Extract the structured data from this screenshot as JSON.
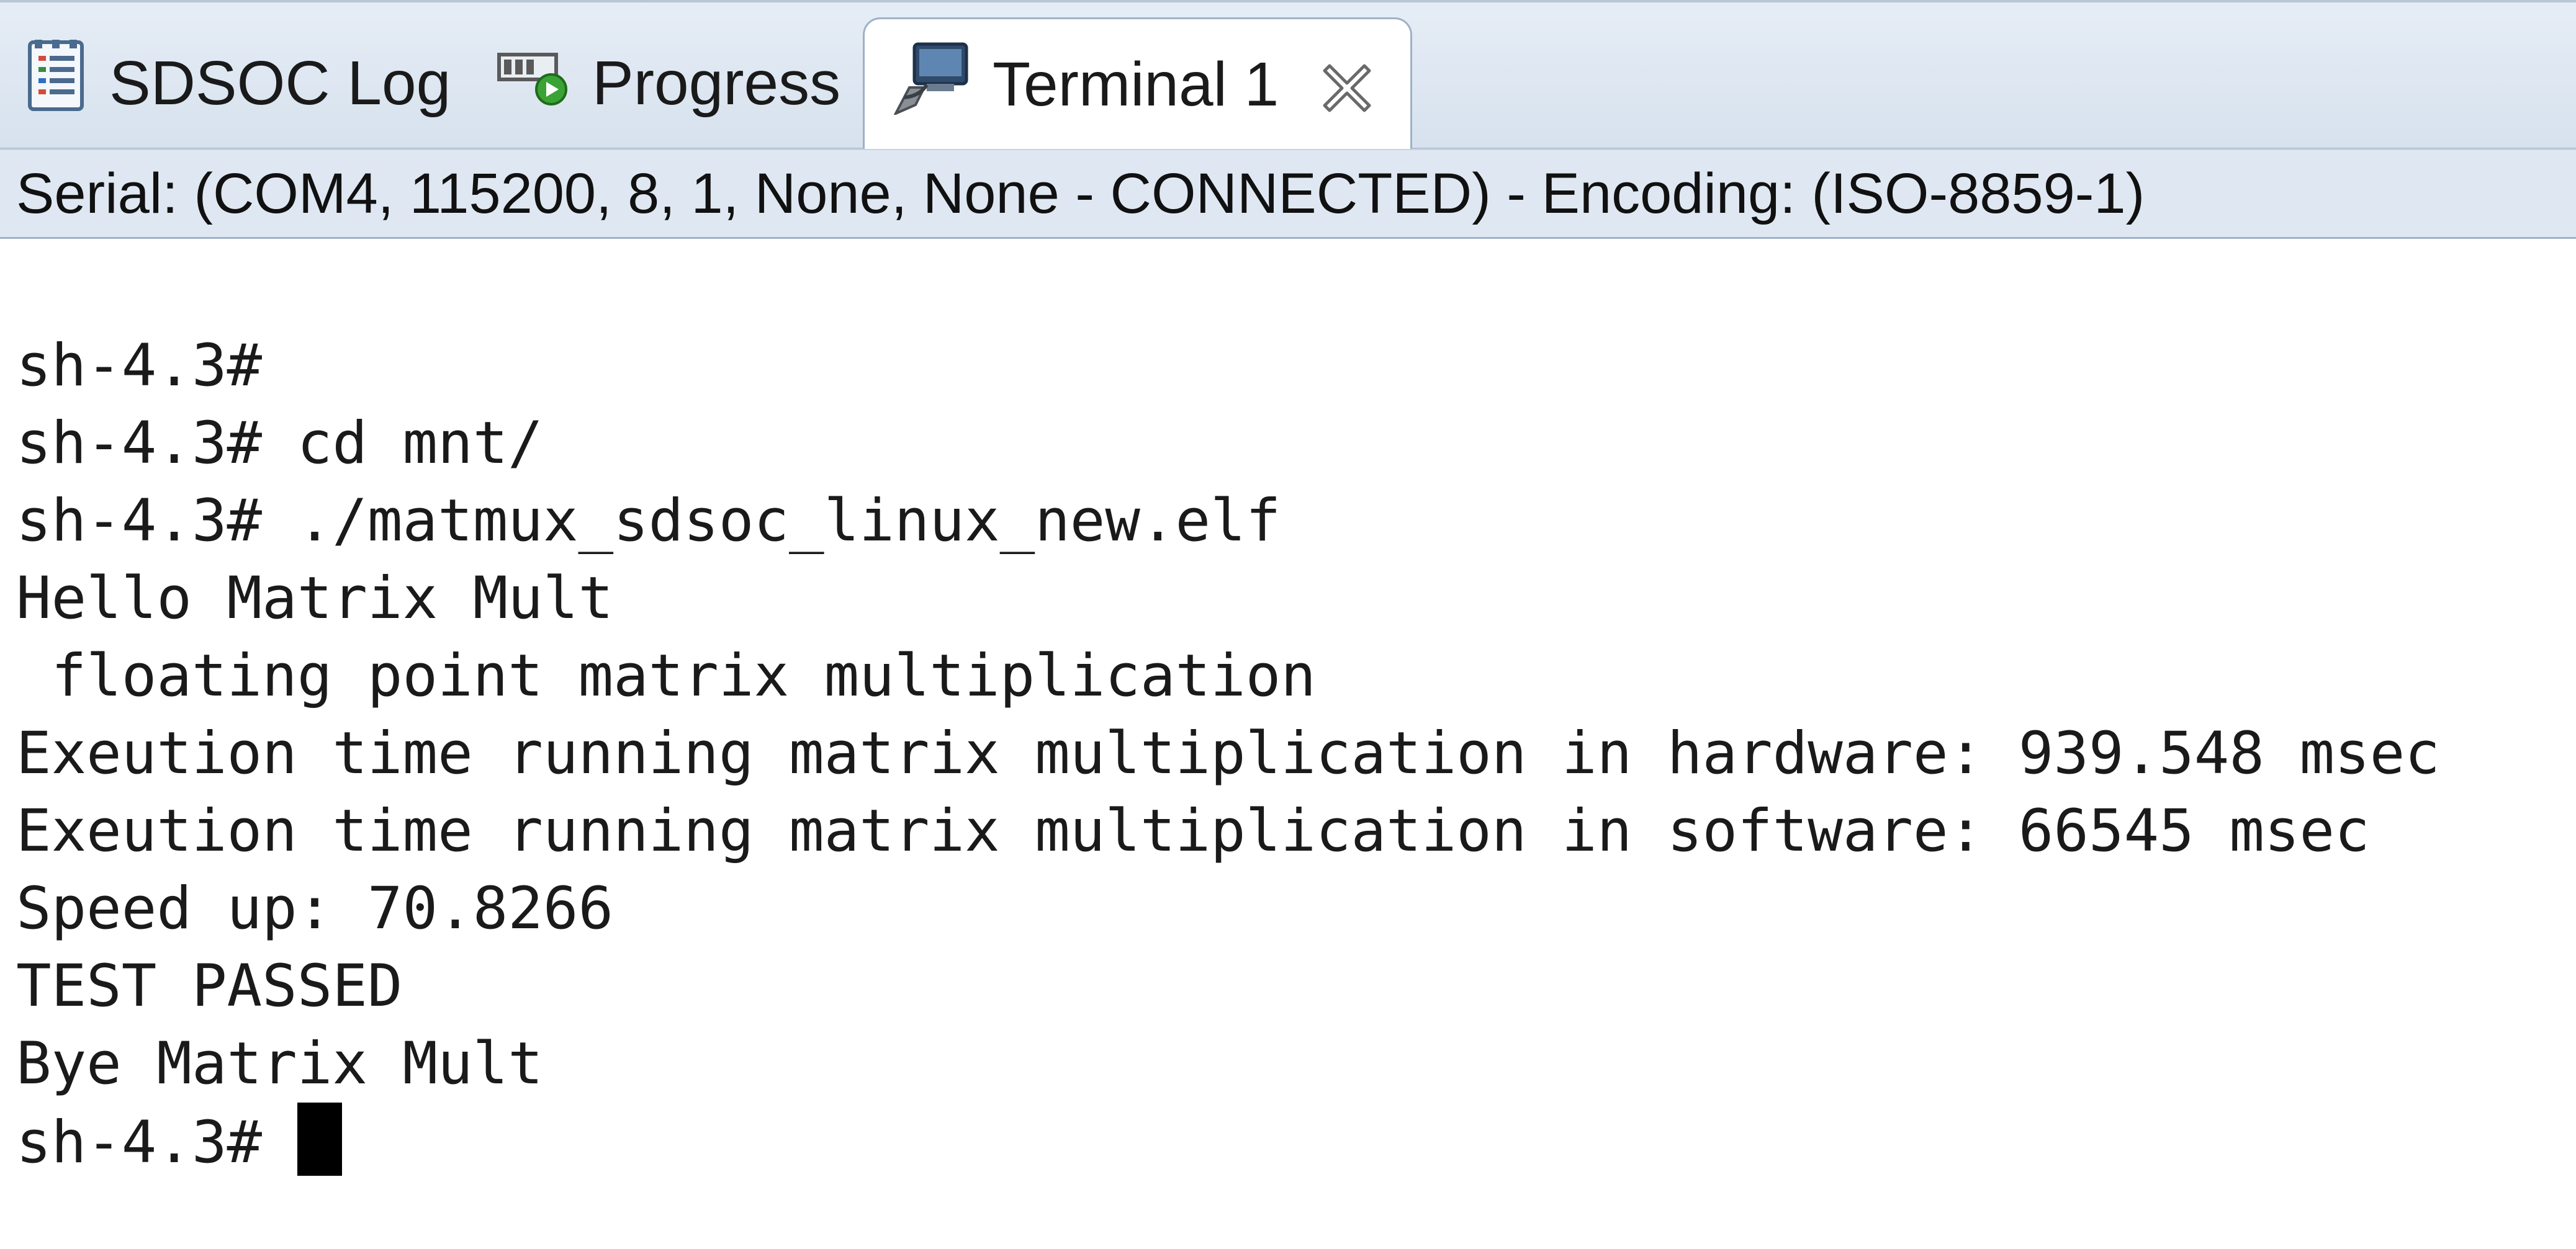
{
  "tabs": {
    "log": {
      "label": "SDSOC Log",
      "icon": "log-icon"
    },
    "progress": {
      "label": "Progress",
      "icon": "progress-icon"
    },
    "terminal": {
      "label": "Terminal 1",
      "icon": "terminal-icon",
      "close_icon": "close-icon",
      "active": true
    }
  },
  "status": {
    "text": "Serial: (COM4, 115200, 8, 1, None, None - CONNECTED) - Encoding: (ISO-8859-1)"
  },
  "terminal": {
    "lines": [
      "sh-4.3#",
      "sh-4.3# cd mnt/",
      "sh-4.3# ./matmux_sdsoc_linux_new.elf",
      "Hello Matrix Mult",
      " floating point matrix multiplication",
      "Exeution time running matrix multiplication in hardware: 939.548 msec",
      "Exeution time running matrix multiplication in software: 66545 msec",
      "Speed up: 70.8266",
      "TEST PASSED",
      "Bye Matrix Mult"
    ],
    "prompt": "sh-4.3# "
  },
  "colors": {
    "tab_strip": "#dde6f1",
    "status_bar": "#dfe8f2",
    "terminal_bg": "#ffffff",
    "text": "#1a1a1a",
    "cursor": "#000000"
  }
}
